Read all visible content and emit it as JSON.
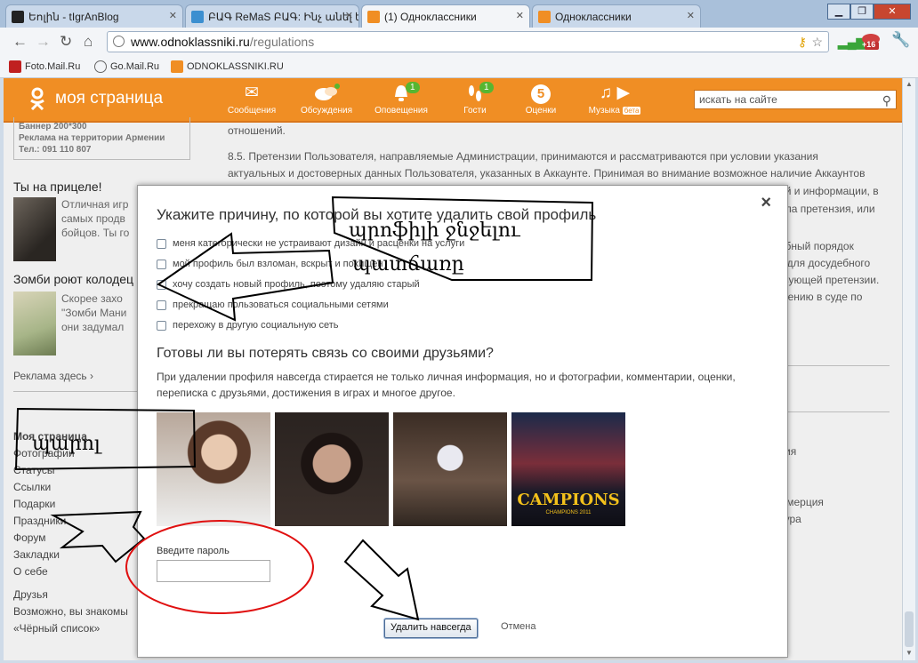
{
  "browser": {
    "tabs": [
      {
        "title": "Եոլին - tIgrAnBlog",
        "icon_color": "#222"
      },
      {
        "title": "ԲԱԳ ReMaS ԲԱԳ: Ինչ անել եթե",
        "icon_color": "#3c8fd0"
      },
      {
        "title": "(1) Одноклассники",
        "icon_color": "#f08e24"
      },
      {
        "title": "Одноклассники",
        "icon_color": "#f08e24"
      }
    ],
    "url_host": "www.odnoklassniki.ru",
    "url_path": "/regulations",
    "bookmarks": [
      "Foto.Mail.Ru",
      "Go.Mail.Ru",
      "ODNOKLASSNIKI.RU"
    ],
    "ext_badge": "+16"
  },
  "ok": {
    "logo_text": "моя страница",
    "nav": [
      {
        "label": "Сообщения",
        "icon": "envelope-icon",
        "glyph": "✉",
        "badge": ""
      },
      {
        "label": "Обсуждения",
        "icon": "chat-icon",
        "glyph": "💬",
        "badge": ""
      },
      {
        "label": "Оповещения",
        "icon": "bell-icon",
        "glyph": "🔔",
        "badge": "1"
      },
      {
        "label": "Гости",
        "icon": "footprints-icon",
        "glyph": "👣",
        "badge": "1"
      },
      {
        "label": "Оценки",
        "icon": "rating-5-icon",
        "glyph": "5",
        "badge": ""
      },
      {
        "label": "Музыка",
        "icon": "music-icon",
        "glyph": "♫",
        "badge": "",
        "tag": "бета"
      }
    ],
    "search_placeholder": "искать на сайте"
  },
  "left": {
    "ad": [
      "Баннер 200*300",
      "Реклама на территории Армении",
      "Тел.: 091 110 807"
    ],
    "promo1_title": "Ты на прицеле!",
    "promo1_text": [
      "Отличная игр",
      "самых продв",
      "бойцов. Ты го"
    ],
    "promo2_title": "Зомби роют колодец",
    "promo2_text": [
      "Скорее захо",
      "\"Зомби Мани",
      "они задумал"
    ],
    "ads_link": "Реклама здесь ›",
    "menu_title": "Моя страница",
    "menu": [
      "Фотографии",
      "Статусы",
      "Ссылки",
      "Подарки",
      "Праздники",
      "Форум",
      "Закладки",
      "О себе"
    ],
    "menu2": [
      "Друзья",
      "Возможно, вы знакомы",
      "«Чёрный список»"
    ]
  },
  "right": {
    "lines": [
      "отношений.",
      "8.5. Претензии Пользователя, направляемые Администрации, принимаются и рассматриваются при условии указания",
      "актуальных и достоверных данных Пользователя, указанных в Аккаунте. Принимая во внимание возможное наличие Аккаунтов"
    ],
    "fragments": [
      "ий и информации, в",
      "ила претензия, или",
      "ебный порядок",
      "к для досудебного",
      "гвующей претензии.",
      "шению в суде по"
    ],
    "footer_links": [
      "сия",
      "ммерция",
      "тура"
    ]
  },
  "modal": {
    "title": "Укажите причину, по которой вы хотите удалить свой профиль",
    "reasons": [
      "меня категорически не устраивают дизайн и расценки на услуги",
      "мой профиль был взломан, вскрыт и похищен",
      "хочу создать новый профиль, поэтому удаляю старый",
      "прекращаю пользоваться социальными сетями",
      "перехожу в другую социальную сеть"
    ],
    "heading2": "Готовы ли вы потерять связь со своими друзьями?",
    "paragraph": "При удалении профиля навсегда стирается не только личная информация, но и фотографии, комментарии, оценки, переписка с друзьями, достижения в играх и многое другое.",
    "campions_text": "CAMPIONS",
    "campions_sub": "CHAMPIONS 2011",
    "password_label": "Введите пароль",
    "delete_button": "Удалить навсегда",
    "cancel_link": "Отмена",
    "close_glyph": "×"
  },
  "annotations": {
    "box1_line1": "պրոֆիլի ջնջելու",
    "box1_line2": "պատճառը",
    "box2_text": "պարոլ"
  }
}
